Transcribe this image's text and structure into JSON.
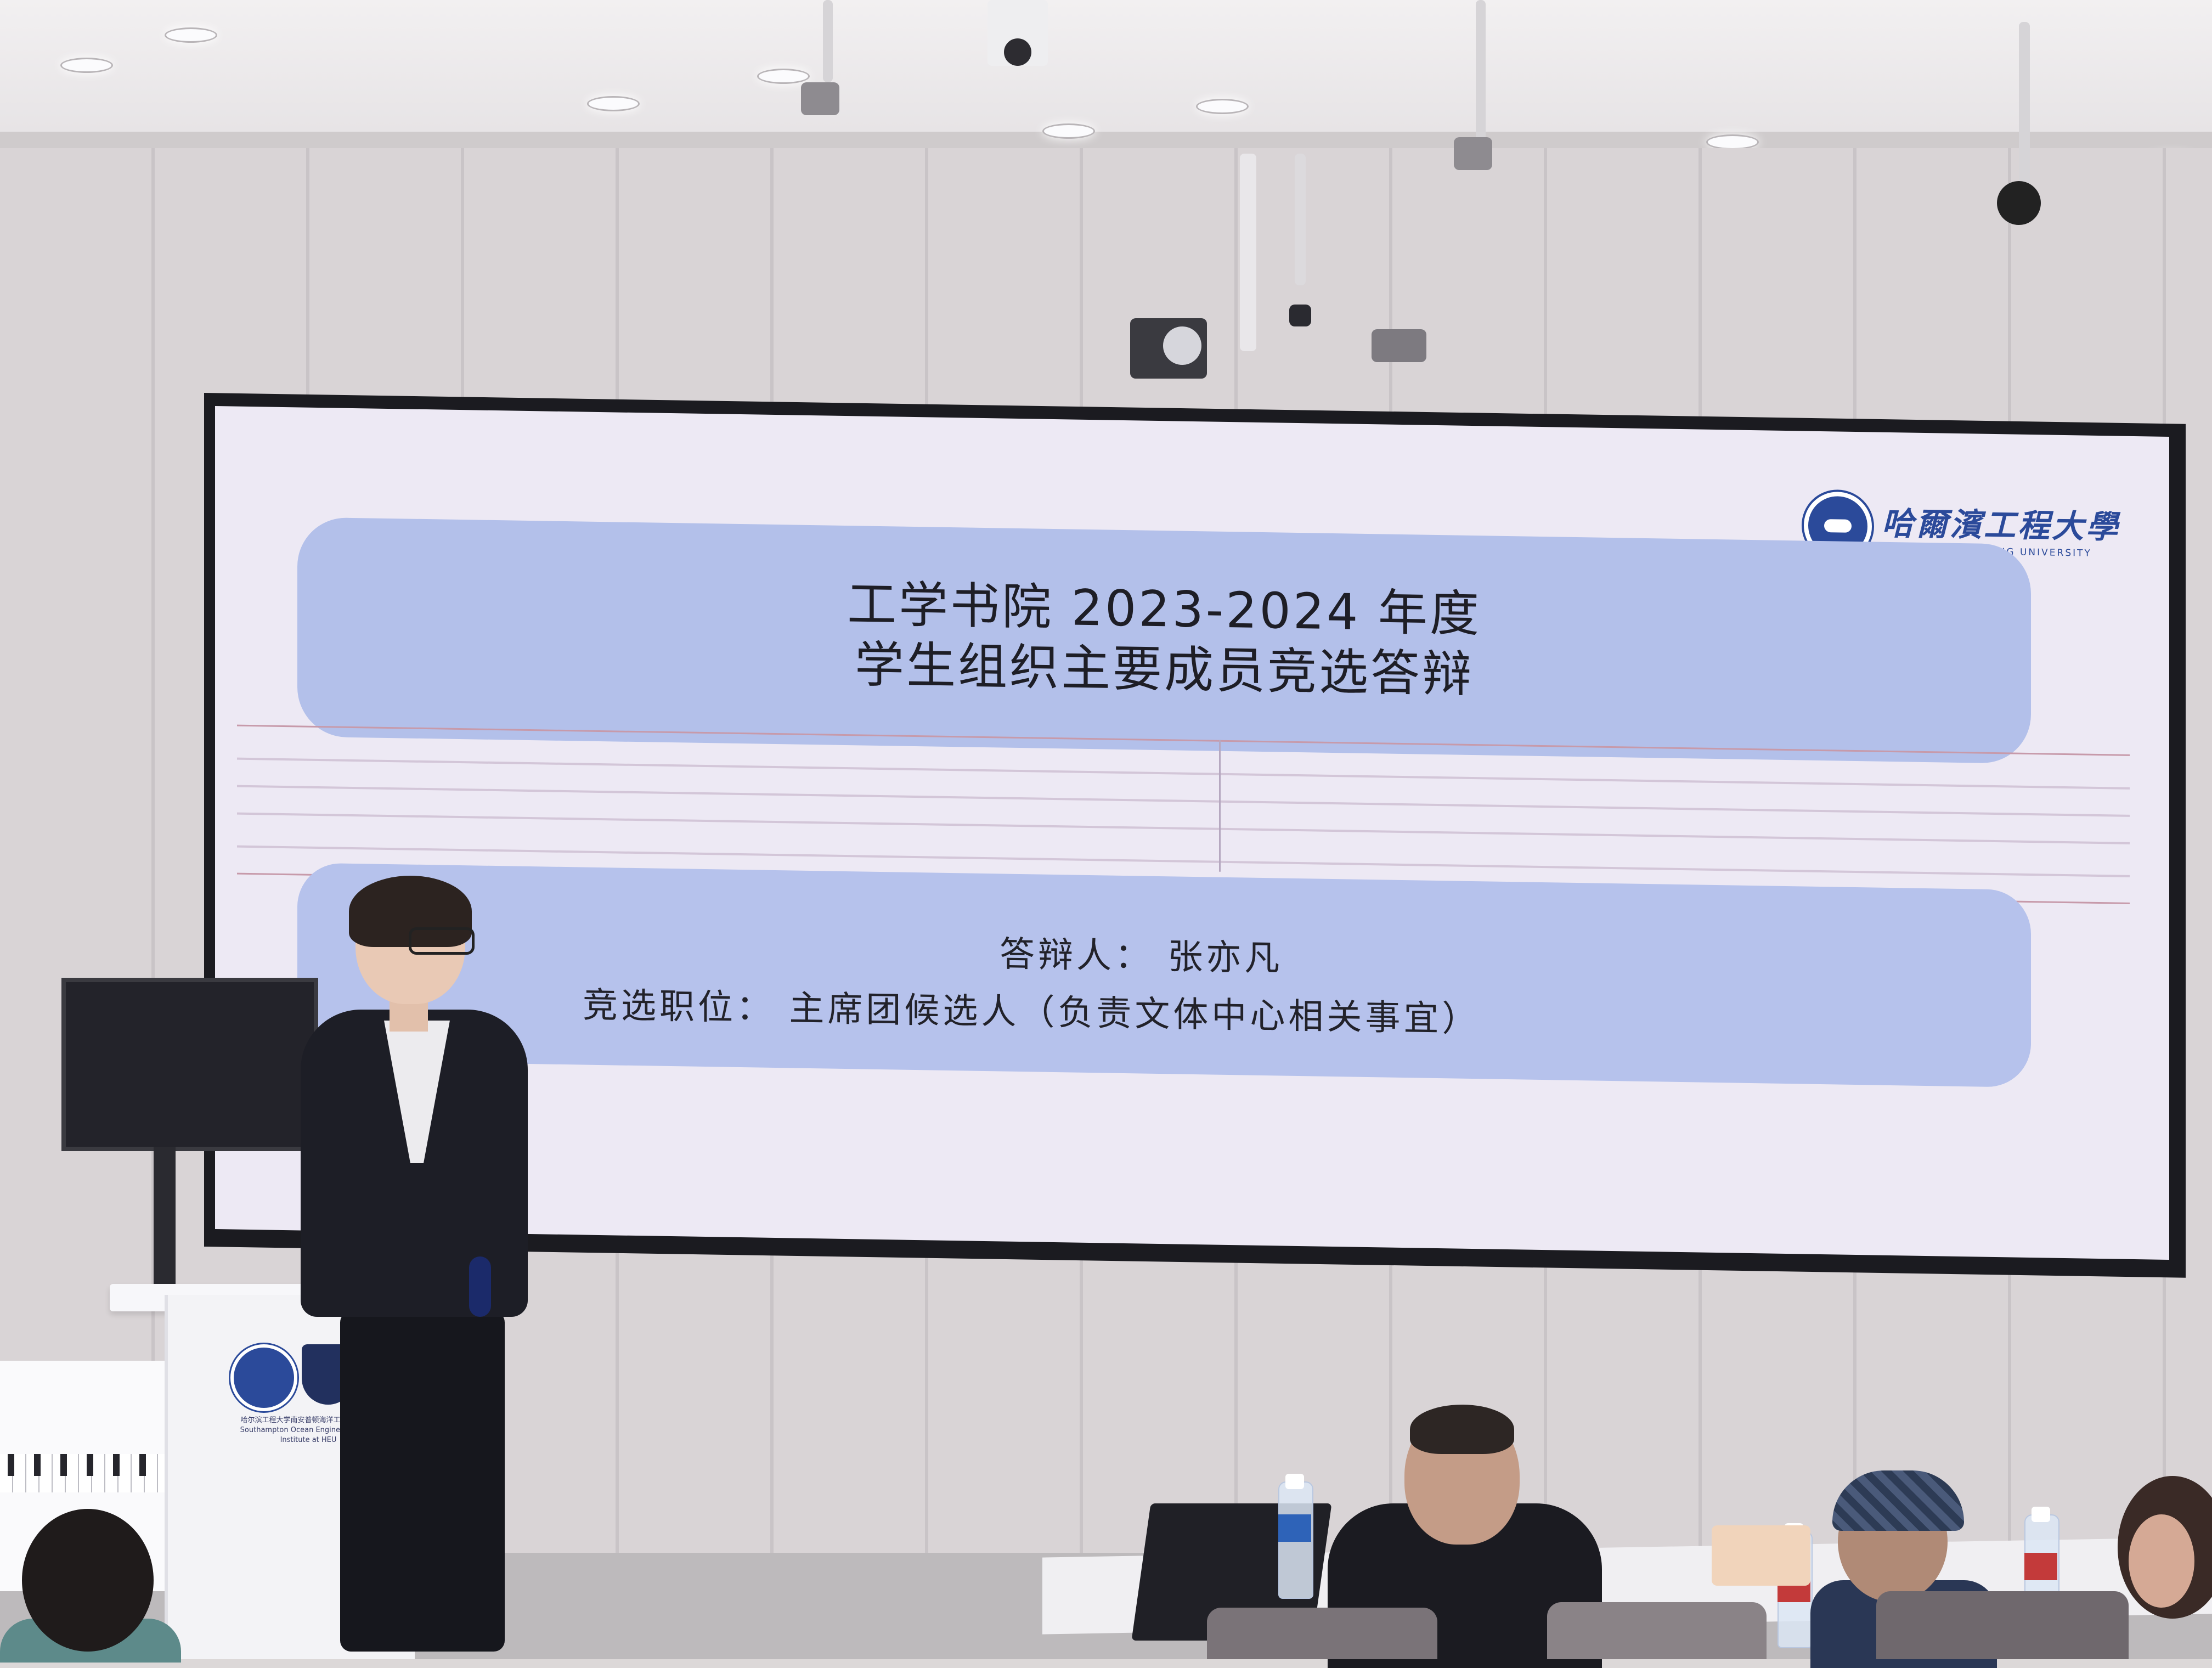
{
  "slide": {
    "university_logo": {
      "name_cn": "哈爾濱工程大學",
      "name_en": "HARBIN ENGINEERING UNIVERSITY"
    },
    "title_line1": "工学书院 2023-2024 年度",
    "title_line2": "学生组织主要成员竞选答辩",
    "defender_line": "答辩人：  张亦凡",
    "position_line": "竞选职位：  主席团候选人（负责文体中心相关事宜）"
  },
  "podium": {
    "caption_cn": "哈尔滨工程大学南安普顿海洋工程联合学院",
    "caption_en": "Southampton Ocean Engineering Joint Institute at HEU"
  },
  "colors": {
    "slide_background": "#ede9f4",
    "band_blue": "#b3c0ea",
    "logo_blue": "#2b4a9a",
    "screen_bezel": "#1b1b20"
  }
}
